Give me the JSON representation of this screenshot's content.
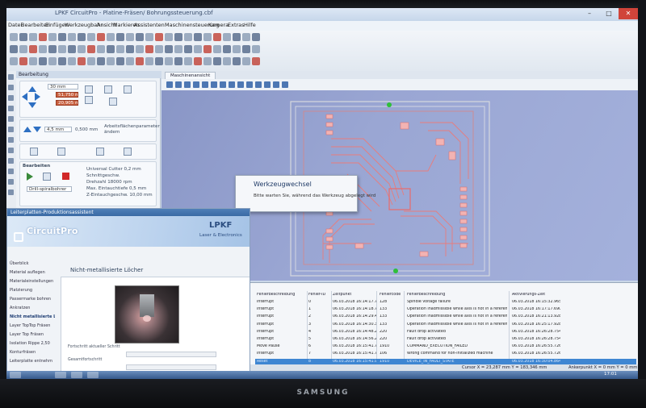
{
  "window": {
    "title": "LPKF CircuitPro - Platine-Fräsen/ Bohrungssteuerung.cbf"
  },
  "menu": [
    "Datei",
    "Bearbeiten",
    "Einfügen",
    "Werkzeugbahn",
    "Ansicht",
    "Markieren",
    "Assistenten",
    "Maschinensteuerung",
    "Kamera",
    "Extras",
    "Hilfe"
  ],
  "left_panel": {
    "header": "Bearbeitung",
    "fields": {
      "x": "30 mm",
      "z1": "51,750 mm",
      "z2": "20,905 mm",
      "depth": "4,5 mm",
      "step": "0,500 mm"
    },
    "offset_note": "Arbeitsflächenparameter ändern",
    "section": "Bearbeiten",
    "tool_select": "Drill-spiralbohrer",
    "tool_info": [
      "Universal Cutter 0,2 mm",
      "Schnittgeschw.",
      "Drehzahl          18000 rpm",
      "Max. Eintauchtiefe   0,5 mm",
      "Z-Eintauchgeschw.   10,00 mm"
    ]
  },
  "main": {
    "tab": "Maschinenansicht"
  },
  "dialog": {
    "title": "Werkzeugwechsel",
    "message": "Bitte warten Sie, während das Werkzeug abgelegt wird"
  },
  "assistant": {
    "title": "Leiterplatten-Produktionsassistent",
    "logo": "CircuitPro",
    "brand": "LPKF",
    "brand_sub": "Laser & Electronics",
    "nav": [
      "Überblick",
      "Material auflegen",
      "Materialeinstellungen",
      "Platzierung",
      "Passermarke bohren",
      "Ankratzen",
      "Nicht metallisierte Lö",
      "Layer TopTop Fräsen",
      "Layer Top Fräsen",
      "Isolation Rippe 2,50",
      "Konturfräsen",
      "Leiterplatte entnehm"
    ],
    "active_nav_index": 6,
    "content_title": "Nicht-metallisierte Löcher",
    "fields": [
      "Fortschritt aktueller Schritt",
      "Gesamtfortschritt"
    ]
  },
  "error_table": {
    "headers": [
      "Fehlerbeschreibung",
      "Fehler-ID",
      "Zeitpunkt",
      "Fehlercode",
      "Fehlerbeschreibung",
      "Aktivierungs-Zeit"
    ],
    "rows": [
      [
        "Interrupt",
        "0",
        "06.03.2018 16:14:17.742",
        "128",
        "Spindle voltage failure",
        "06.03.2018 16:15:32.965"
      ],
      [
        "Interrupt",
        "1",
        "06.03.2018 16:14:18.785",
        "133",
        "Operation inadmissible while axis is not in a referenced state",
        "06.03.2018 16:17:17.690"
      ],
      [
        "Interrupt",
        "2",
        "06.03.2018 16:14:29.436",
        "133",
        "Operation inadmissible while axis is not in a referenced state",
        "06.03.2018 16:21:13.928"
      ],
      [
        "Interrupt",
        "3",
        "06.03.2018 16:14:30.396",
        "133",
        "Operation inadmissible while axis is not in a referenced state",
        "06.03.2018 16:25:17.928"
      ],
      [
        "Interrupt",
        "4",
        "06.03.2018 16:14:48.256",
        "220",
        "Fault drop activated",
        "06.03.2018 16:26:28.754"
      ],
      [
        "Interrupt",
        "5",
        "06.03.2018 16:14:56.216",
        "220",
        "Fault drop activated",
        "06.03.2018 16:26:28.754"
      ],
      [
        "Move Pause",
        "6",
        "06.03.2018 16:15:41.733",
        "1910",
        "COMMAND_EXECUTION_FAILED",
        "06.03.2018 16:26:55.726"
      ],
      [
        "Interrupt",
        "7",
        "06.03.2018 16:15:41.759",
        "106",
        "Wrong command for non-initialized machine",
        "06.03.2018 16:26:55.726"
      ],
      [
        "Reset",
        "8",
        "06.03.2018 16:15:41.962",
        "1910",
        "DEVICE_IN_FAULT_STATE",
        "06.03.2018 16:30:04.864"
      ]
    ],
    "selected_row_index": 8
  },
  "status": {
    "cursor": "Cursor X = 23,287 mm   Y = 183,346 mm",
    "anchor": "Ankerpunkt X = 0 mm   Y = 0 mm"
  },
  "taskbar": {
    "time": "17:01",
    "date": "06.03.2018"
  },
  "bezel": {
    "brand": "SAMSUNG"
  }
}
